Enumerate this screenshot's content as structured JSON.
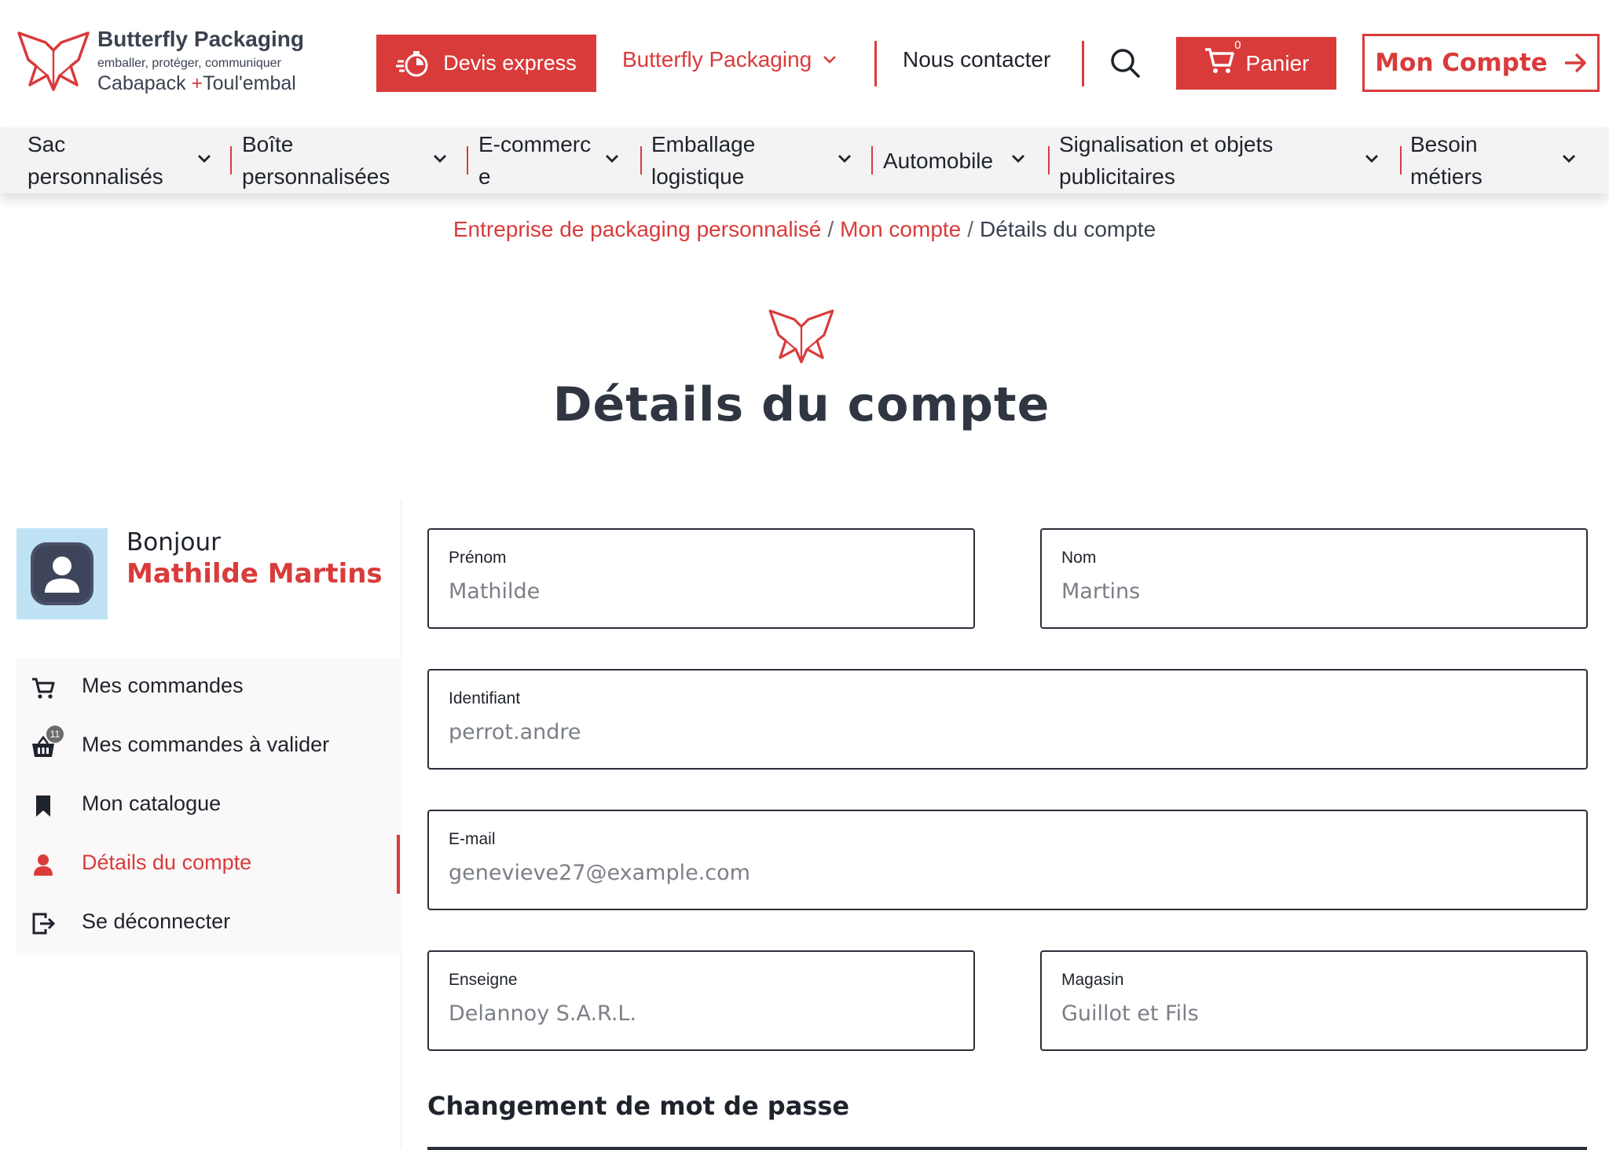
{
  "header": {
    "logo": {
      "brand": "Butterfly Packaging",
      "tagline": "emballer, protéger, communiquer",
      "brand_left": "Cabapack",
      "brand_plus": "+",
      "brand_right": "Toul'embal"
    },
    "devis_label": "Devis express",
    "nav_bp_label": "Butterfly Packaging",
    "contact_label": "Nous contacter",
    "cart": {
      "label": "Panier",
      "count": "0"
    },
    "account_label": "Mon Compte",
    "icons": [
      "stopwatch-icon",
      "chevron-down-icon",
      "search-icon",
      "cart-icon",
      "arrow-right-icon"
    ]
  },
  "categories": [
    {
      "label": "Sac personnalisés"
    },
    {
      "label": "Boîte personnalisées"
    },
    {
      "label": "E-commerce"
    },
    {
      "label": "Emballage logistique"
    },
    {
      "label": "Automobile"
    },
    {
      "label": "Signalisation et objets publicitaires"
    },
    {
      "label": "Besoin métiers"
    }
  ],
  "breadcrumb": {
    "items": [
      {
        "label": "Entreprise de packaging personnalisé",
        "link": true
      },
      {
        "label": "Mon compte",
        "link": true
      },
      {
        "label": "Détails du compte",
        "link": false
      }
    ],
    "separator": "/"
  },
  "page": {
    "title": "Détails du compte"
  },
  "sidebar": {
    "greeting": "Bonjour",
    "user_name": "Mathilde Martins",
    "menu": [
      {
        "label": "Mes commandes",
        "icon": "cart-icon"
      },
      {
        "label": "Mes commandes à valider",
        "icon": "basket-icon",
        "badge": "11"
      },
      {
        "label": "Mon catalogue",
        "icon": "bookmark-icon"
      },
      {
        "label": "Détails du compte",
        "icon": "user-icon",
        "active": true
      },
      {
        "label": "Se déconnecter",
        "icon": "logout-icon"
      }
    ]
  },
  "form": {
    "prenom": {
      "label": "Prénom",
      "value": "Mathilde"
    },
    "nom": {
      "label": "Nom",
      "value": "Martins"
    },
    "identifiant": {
      "label": "Identifiant",
      "value": "perrot.andre"
    },
    "email": {
      "label": "E-mail",
      "value": "genevieve27@example.com"
    },
    "enseigne": {
      "label": "Enseigne",
      "value": "Delannoy S.A.R.L."
    },
    "magasin": {
      "label": "Magasin",
      "value": "Guillot et Fils"
    },
    "password_section_title": "Changement de mot de passe"
  },
  "colors": {
    "accent": "#d93b3b",
    "text": "#1f232b",
    "muted": "#7b7f86",
    "nav_bg": "#f3f3f4",
    "avatar_bg": "#bfe3f5"
  }
}
